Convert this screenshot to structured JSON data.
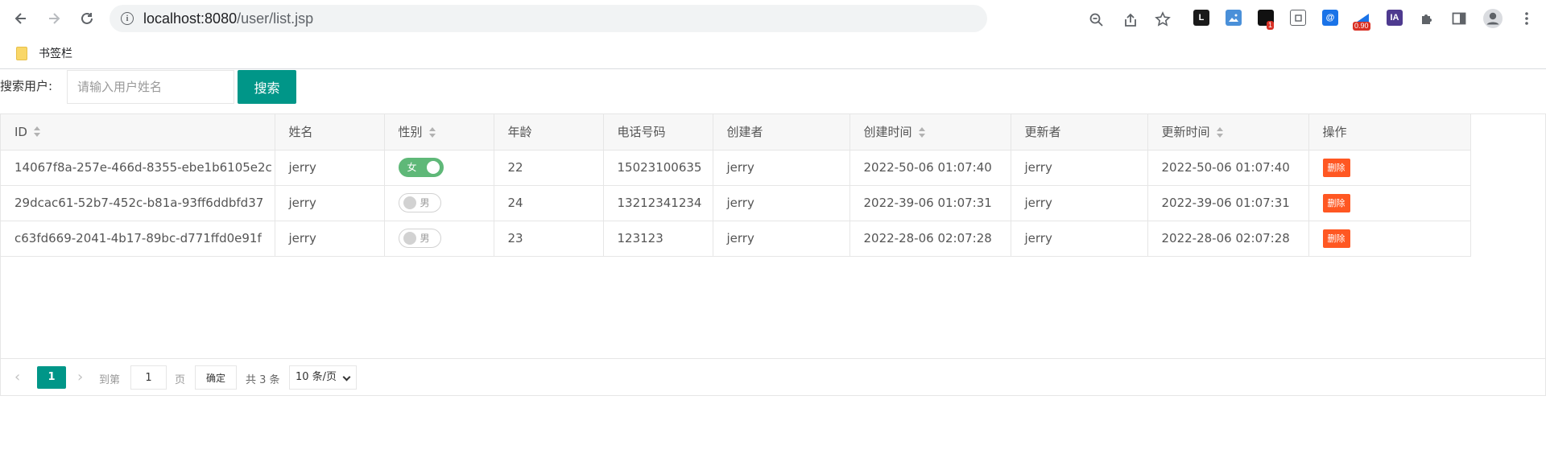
{
  "browser": {
    "url_host": "localhost:8080",
    "url_path": "/user/list.jsp",
    "extensions": [
      {
        "name": "leetcode-ext",
        "label": "L",
        "bg": "#1a1a1a",
        "color": "#fff"
      },
      {
        "name": "image-ext",
        "label": "▣",
        "bg": "#4a90d9",
        "color": "#fff"
      },
      {
        "name": "counter-ext",
        "label": "■",
        "bg": "#fff",
        "color": "#111",
        "badge": "1"
      },
      {
        "name": "copy-ext",
        "label": "❐",
        "bg": "#fff",
        "color": "#5f6368"
      },
      {
        "name": "mail-ext",
        "label": "@",
        "bg": "#1a73e8",
        "color": "#fff"
      },
      {
        "name": "score-ext",
        "label": "◣",
        "bg": "#fff",
        "color": "#1a73e8",
        "badge": "0.90"
      },
      {
        "name": "ia-ext",
        "label": "IA",
        "bg": "#4e3a8f",
        "color": "#fff"
      }
    ]
  },
  "bookmarks": {
    "folder_label": "书签栏"
  },
  "search": {
    "label": "搜索用户:",
    "placeholder": "请输入用户姓名",
    "button_label": "搜索"
  },
  "table": {
    "headers": [
      "ID",
      "姓名",
      "性别",
      "年龄",
      "电话号码",
      "创建者",
      "创建时间",
      "更新者",
      "更新时间",
      "操作"
    ],
    "rows": [
      {
        "id": "14067f8a-257e-466d-8355-ebe1b6105e2c",
        "name": "jerry",
        "gender": "女",
        "gender_on": true,
        "age": "22",
        "phone": "15023100635",
        "creator": "jerry",
        "created": "2022-50-06 01:07:40",
        "updater": "jerry",
        "updated": "2022-50-06 01:07:40",
        "action": "删除"
      },
      {
        "id": "29dcac61-52b7-452c-b81a-93ff6ddbfd37",
        "name": "jerry",
        "gender": "男",
        "gender_on": false,
        "age": "24",
        "phone": "13212341234",
        "creator": "jerry",
        "created": "2022-39-06 01:07:31",
        "updater": "jerry",
        "updated": "2022-39-06 01:07:31",
        "action": "删除"
      },
      {
        "id": "c63fd669-2041-4b17-89bc-d771ffd0e91f",
        "name": "jerry",
        "gender": "男",
        "gender_on": false,
        "age": "23",
        "phone": "123123",
        "creator": "jerry",
        "created": "2022-28-06 02:07:28",
        "updater": "jerry",
        "updated": "2022-28-06 02:07:28",
        "action": "删除"
      }
    ]
  },
  "pager": {
    "current_page": "1",
    "goto_label": "到第",
    "goto_value": "1",
    "page_suffix": "页",
    "confirm_label": "确定",
    "total_label": "共 3 条",
    "page_size": "10 条/页"
  },
  "colors": {
    "primary": "#009688",
    "danger": "#ff5722",
    "switch_on": "#5fb878"
  }
}
